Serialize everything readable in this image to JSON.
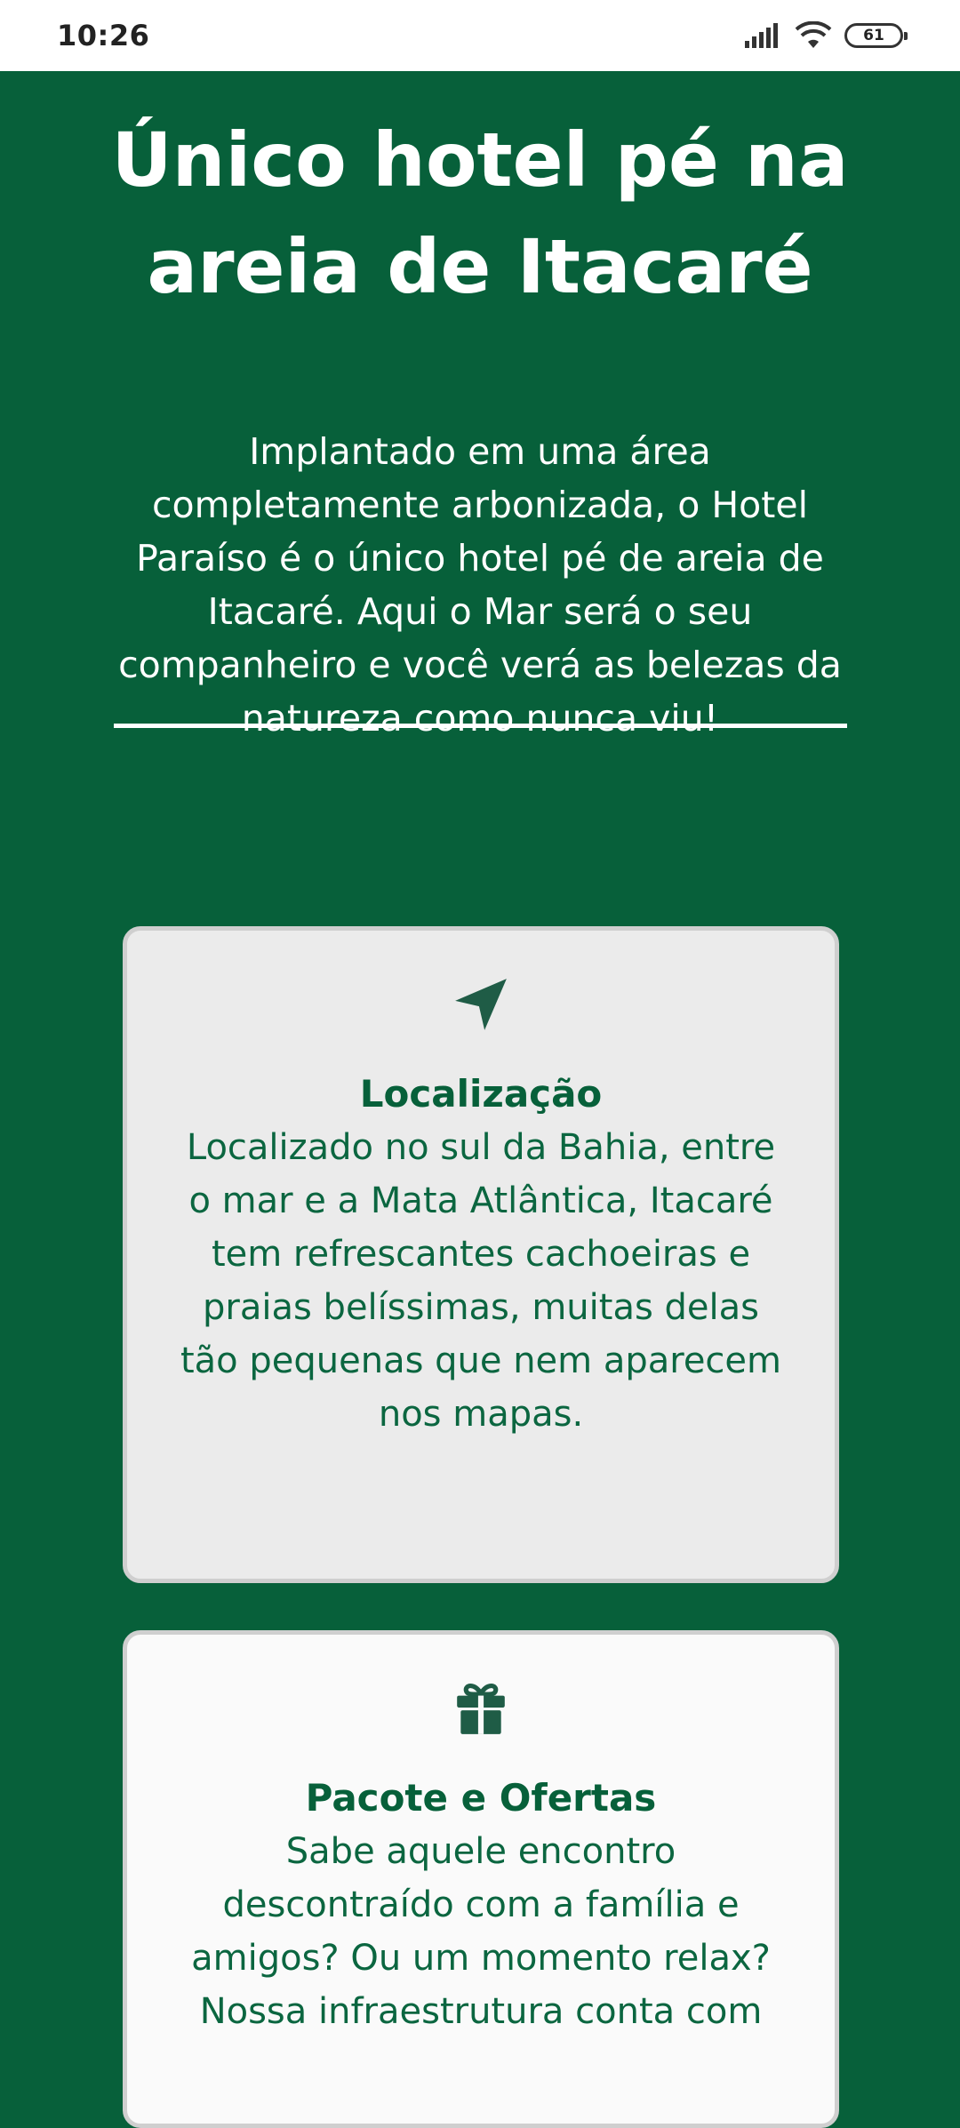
{
  "status_bar": {
    "time": "10:26",
    "battery": "61"
  },
  "hero": {
    "title": "Único hotel pé na\nareia de Itacaré",
    "text": "Implantado em uma área completamente arbonizada, o Hotel Paraíso é o único hotel pé de areia de Itacaré. Aqui o Mar será o seu companheiro e você verá as belezas da natureza como nunca viu!"
  },
  "cards": [
    {
      "icon": "location-arrow-icon",
      "title": "Localização",
      "text": "Localizado no sul da Bahia, entre o mar e a Mata Atlântica, Itacaré tem refrescantes cachoeiras e praias belíssimas, muitas delas tão pequenas que nem aparecem nos mapas."
    },
    {
      "icon": "gift-icon",
      "title": "Pacote e Ofertas",
      "text": "Sabe aquele encontro descontraído com a família e amigos? Ou um momento relax? Nossa infraestrutura conta com"
    }
  ],
  "colors": {
    "brand_green": "#07603a",
    "card_gray": "#ebebeb",
    "card_white": "#fafafa",
    "text_white": "#ffffff"
  }
}
